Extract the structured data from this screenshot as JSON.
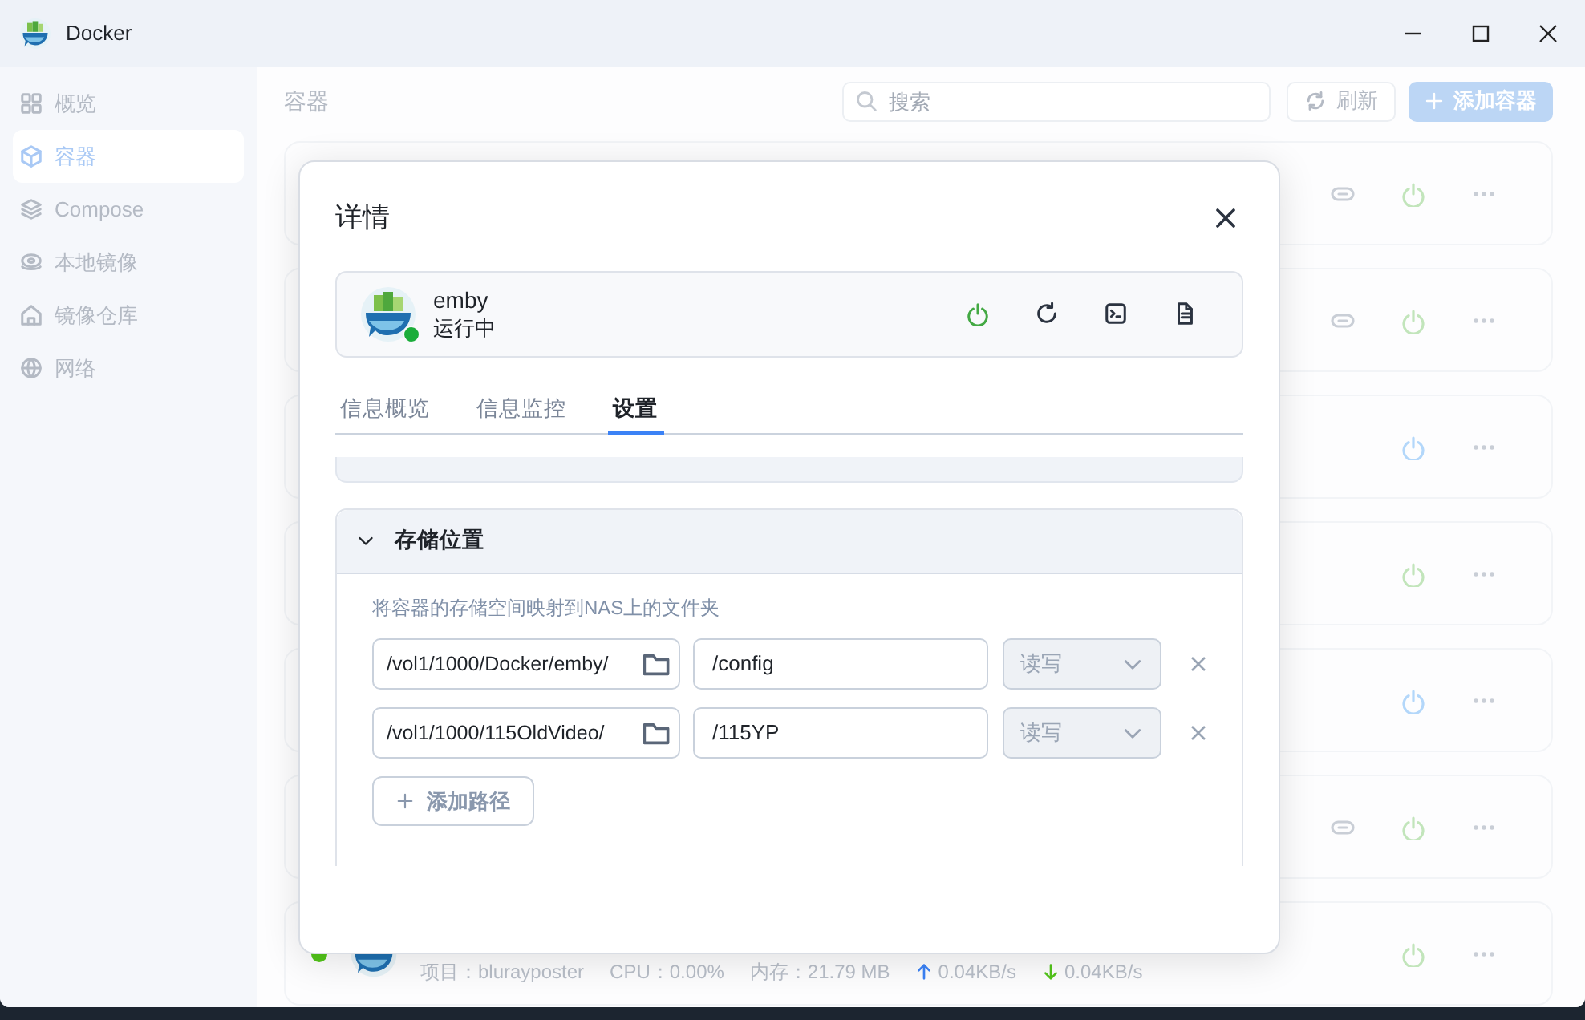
{
  "window": {
    "title": "Docker"
  },
  "sidebar": {
    "items": [
      {
        "label": "概览",
        "selected": false
      },
      {
        "label": "容器",
        "selected": true
      },
      {
        "label": "Compose",
        "selected": false
      },
      {
        "label": "本地镜像",
        "selected": false
      },
      {
        "label": "镜像仓库",
        "selected": false
      },
      {
        "label": "网络",
        "selected": false
      }
    ]
  },
  "page": {
    "title": "容器",
    "search": {
      "placeholder": "搜索"
    },
    "buttons": [
      {
        "label": "刷新",
        "kind": "refresh"
      },
      {
        "label": "添加容器",
        "kind": "add"
      }
    ]
  },
  "containers": [
    {
      "link": true,
      "color": "#c2e5bb"
    },
    {
      "link": true,
      "color": "#c2e5bb"
    },
    {
      "link": false,
      "color": "#b3d7fa"
    },
    {
      "link": false,
      "color": "#c2e5bb"
    },
    {
      "link": false,
      "color": "#b3d7fa"
    },
    {
      "link": true,
      "color": "#c2e5bb"
    },
    {
      "link": false,
      "color": "#c2e5bb",
      "running": true,
      "stats": {
        "project": "项目：blurayposter",
        "cpu": "CPU：0.00%",
        "memory": "内存：21.79 MB",
        "upload": "0.04KB/s",
        "download": "0.04KB/s"
      }
    }
  ],
  "dialog": {
    "title": "详情",
    "container": {
      "name": "emby",
      "status": "运行中",
      "running": true
    },
    "tabs": [
      {
        "label": "信息概览",
        "selected": false
      },
      {
        "label": "信息监控",
        "selected": false
      },
      {
        "label": "设置",
        "selected": true
      }
    ],
    "storage": {
      "title": "存储位置",
      "expanded": true,
      "description": "将容器的存储空间映射到NAS上的文件夹",
      "mappings": [
        {
          "host_path": "/vol1/1000/Docker/emby/",
          "container_path": "/config",
          "mode": "读写",
          "disabled": true
        },
        {
          "host_path": "/vol1/1000/115OldVideo/",
          "container_path": "/115YP",
          "mode": "读写",
          "disabled": true
        }
      ],
      "add_button": "添加路径"
    }
  }
}
